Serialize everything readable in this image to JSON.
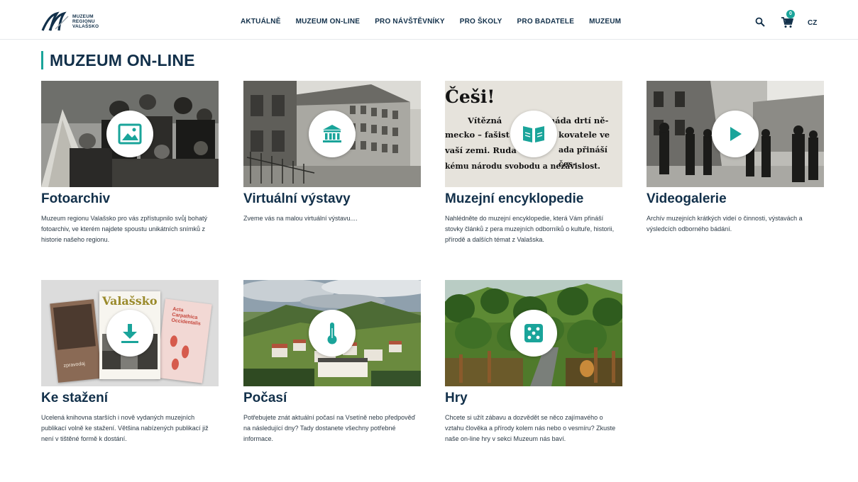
{
  "header": {
    "logo_lines": [
      "MUZEUM",
      "REGIONU",
      "VALAŠSKO"
    ],
    "nav": [
      "AKTUÁLNĚ",
      "MUZEUM ON-LINE",
      "PRO NÁVŠTĚVNÍKY",
      "PRO ŠKOLY",
      "PRO BADATELE",
      "MUZEUM"
    ],
    "cart_count": "0",
    "language": "CZ"
  },
  "page": {
    "title": "MUZEUM ON-LINE"
  },
  "colors": {
    "accent": "#1aa49a",
    "text_dark": "#12304a"
  },
  "cards": [
    {
      "title": "Fotoarchiv",
      "icon": "image-icon",
      "description": "Muzeum regionu Valašsko pro vás zpřístupnilo svůj bohatý fotoarchiv, ve kterém najdete spoustu unikátních snímků z historie našeho regionu."
    },
    {
      "title": "Virtuální výstavy",
      "icon": "museum-icon",
      "description": "Zveme vás na malou virtuální výstavu...."
    },
    {
      "title": "Muzejní encyklopedie",
      "icon": "book-icon",
      "description": "Nahlédněte do muzejní encyklopedie, která Vám přináší stovky článků z pera muzejních odborníků o kultuře, historii, přírodě a dalších témat z Valašska.",
      "image_text": [
        "Češi!",
        "Vítězná",
        "máda drtí ně-",
        "mecko – fašist",
        "kovatele ve",
        "vaší zemi. Ruda",
        "ada přináší čes-",
        "kému národu svobodu a nezávislost."
      ]
    },
    {
      "title": "Videogalerie",
      "icon": "play-icon",
      "description": "Archív muzejních krátkých videí o činnosti, výstavách a výsledcích odborného bádání."
    },
    {
      "title": "Ke stažení",
      "icon": "download-icon",
      "description": "Ucelená knihovna starších i nově vydaných muzejních publikací volně ke stažení. Většina nabízených publikací již není v tištěné formě k dostání.",
      "image_text": [
        "Valašsko",
        "zpravodaj",
        "Acta Carpathica Occidentalis"
      ]
    },
    {
      "title": "Počasí",
      "icon": "thermometer-icon",
      "description": "Potřebujete znát aktuální počasí na Vsetíně nebo předpověď na následující dny? Tady dostanete všechny potřebné informace."
    },
    {
      "title": "Hry",
      "icon": "dice-icon",
      "description": "Chcete si užít zábavu a dozvědět se něco zajímavého o vztahu člověka a přírody kolem nás nebo o vesmíru? Zkuste naše on-line hry v sekci Muzeum nás baví."
    }
  ]
}
